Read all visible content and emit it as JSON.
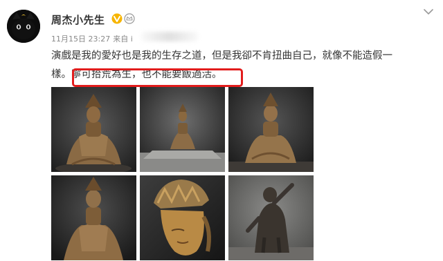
{
  "author": {
    "name": "周杰小先生",
    "avatar_icon": "black-cat-avatar",
    "verified_icon": "verified-v-icon",
    "member_icon": "member-crown-icon"
  },
  "meta": {
    "date": "11月15日 23:27",
    "source_prefix": "来自 i"
  },
  "post": {
    "line1": "演戲是我的愛好也是我的生存之道，但是我卻不肯扭曲自己，就像不能造假一",
    "line2_start": "樣。",
    "line2_highlight": "寧可拾荒為生，也不能要飯過活。"
  },
  "colors": {
    "highlight_border": "#e21c1c",
    "verified_badge": "#f7b500",
    "meta_text": "#888888"
  },
  "gallery": {
    "images": [
      {
        "label": "seated-bodhisattva-front"
      },
      {
        "label": "seated-figure-in-gallery"
      },
      {
        "label": "seated-bodhisattva-side"
      },
      {
        "label": "bodhisattva-statue-closeup"
      },
      {
        "label": "crowned-head-profile"
      },
      {
        "label": "guardian-figure-statue"
      }
    ]
  }
}
